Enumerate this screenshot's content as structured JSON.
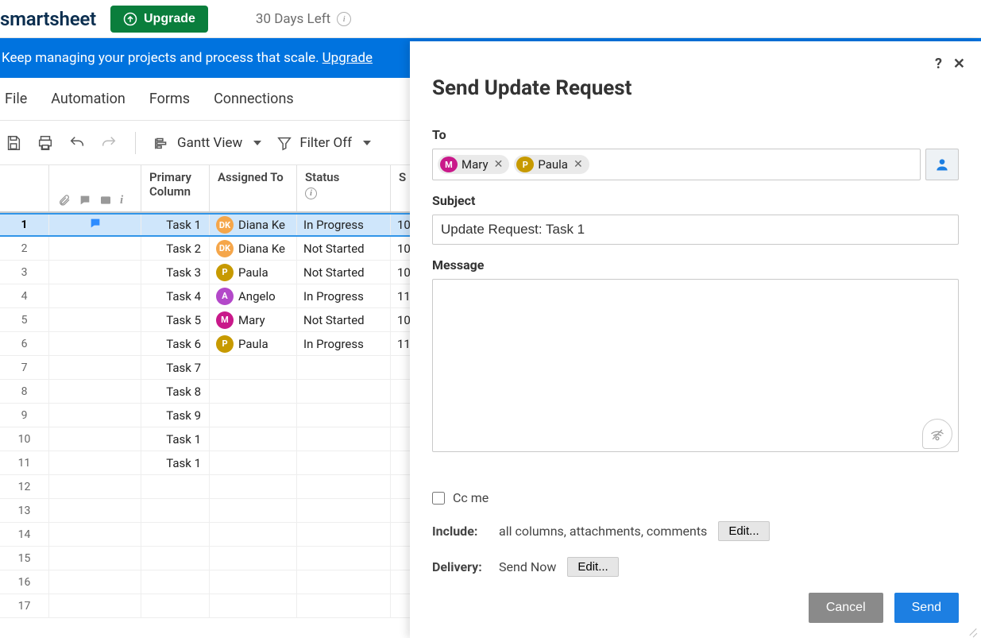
{
  "header": {
    "logo": "smartsheet",
    "upgrade_label": "Upgrade",
    "trial_text": "30 Days Left"
  },
  "banner": {
    "text": "Keep managing your projects and process that scale.",
    "link_label": "Upgrade"
  },
  "menu": {
    "file": "File",
    "automation": "Automation",
    "forms": "Forms",
    "connections": "Connections"
  },
  "toolbar": {
    "view_label": "Gantt View",
    "filter_label": "Filter Off"
  },
  "columns": {
    "primary": "Primary Column",
    "assigned": "Assigned To",
    "status": "Status",
    "s": "S"
  },
  "rows": [
    {
      "num": "1",
      "task": "Task 1",
      "assignee": "Diana Ke",
      "initials": "DK",
      "color": "#f5a64a",
      "status": "In Progress",
      "s": "10",
      "selected": true,
      "has_comment": true
    },
    {
      "num": "2",
      "task": "Task 2",
      "assignee": "Diana Ke",
      "initials": "DK",
      "color": "#f5a64a",
      "status": "Not Started",
      "s": "10"
    },
    {
      "num": "3",
      "task": "Task 3",
      "assignee": "Paula",
      "initials": "P",
      "color": "#c79a00",
      "status": "Not Started",
      "s": "10"
    },
    {
      "num": "4",
      "task": "Task 4",
      "assignee": "Angelo",
      "initials": "A",
      "color": "#b348c9",
      "status": "In Progress",
      "s": "11"
    },
    {
      "num": "5",
      "task": "Task 5",
      "assignee": "Mary",
      "initials": "M",
      "color": "#c9198a",
      "status": "Not Started",
      "s": "10"
    },
    {
      "num": "6",
      "task": "Task 6",
      "assignee": "Paula",
      "initials": "P",
      "color": "#c79a00",
      "status": "In Progress",
      "s": "11"
    },
    {
      "num": "7",
      "task": "Task 7"
    },
    {
      "num": "8",
      "task": "Task 8"
    },
    {
      "num": "9",
      "task": "Task 9"
    },
    {
      "num": "10",
      "task": "Task 1"
    },
    {
      "num": "11",
      "task": "Task 1"
    },
    {
      "num": "12",
      "task": ""
    },
    {
      "num": "13",
      "task": ""
    },
    {
      "num": "14",
      "task": ""
    },
    {
      "num": "15",
      "task": ""
    },
    {
      "num": "16",
      "task": ""
    },
    {
      "num": "17",
      "task": ""
    }
  ],
  "modal": {
    "title": "Send Update Request",
    "to_label": "To",
    "recipients": [
      {
        "name": "Mary",
        "initial": "M",
        "color": "#c9198a"
      },
      {
        "name": "Paula",
        "initial": "P",
        "color": "#c79a00"
      }
    ],
    "subject_label": "Subject",
    "subject_value": "Update Request: Task 1",
    "message_label": "Message",
    "message_value": "",
    "cc_label": "Cc me",
    "include_label": "Include:",
    "include_value": "all columns, attachments, comments",
    "edit_label": "Edit...",
    "delivery_label": "Delivery:",
    "delivery_value": "Send Now",
    "cancel_label": "Cancel",
    "send_label": "Send"
  }
}
